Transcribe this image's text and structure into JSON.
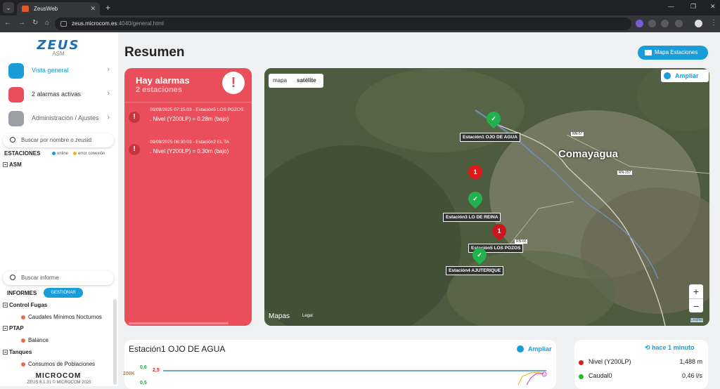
{
  "browser": {
    "tab_title": "ZeusWeb",
    "url_host": "zeus.microcom.es",
    "url_path": ":4040/general.html"
  },
  "sidebar": {
    "logo": "ZEUS",
    "logo_sub": "ASM",
    "menu": [
      {
        "label": "Vista general",
        "color": "#1a9cd8"
      },
      {
        "label": "2 alarmas activas",
        "color": "#e94e5a"
      },
      {
        "label": "Administración / Ajustes",
        "color": "#9aa0a6"
      }
    ],
    "search_stations_placeholder": "Buscar por nombre o zeusid",
    "stations_title": "ESTACIONES",
    "legend_online": "online",
    "legend_error": "error conexión",
    "tree_root": "ASM",
    "search_reports_placeholder": "Buscar informe",
    "reports_title": "INFORMES",
    "gestionar": "GESTIONAR",
    "report_groups": [
      {
        "name": "Control Fugas",
        "children": [
          "Caudales Mínimos Nocturnos"
        ]
      },
      {
        "name": "PTAP",
        "children": [
          "Balance"
        ]
      },
      {
        "name": "Tanques",
        "children": [
          "Consumos de Poblaciones"
        ]
      }
    ],
    "footer_logo": "MICROCOM",
    "footer_version": "ZEUS 6.1.31 © MICROCOM 2025"
  },
  "main": {
    "title": "Resumen",
    "map_button": "Mapa Estaciones",
    "alarms": {
      "title": "Hay alarmas",
      "subtitle": "2 estaciones",
      "items": [
        {
          "line1": "09/09/2025 07:15:03 - Estación5 LOS POZOS",
          "line2": ". Nivel (Y200LP) = 0.28m (bajo)"
        },
        {
          "line1": "09/09/2025 06:30:03 - Estación2 EL TA",
          "line2": ". Nivel (Y200LP) = 0.30m (bajo)"
        }
      ]
    },
    "map": {
      "tab_map": "mapa",
      "tab_sat": "satélite",
      "ampliar": "Ampliar",
      "city": "Comayagua",
      "roads": [
        "RN-57",
        "RN-157",
        "RN-66"
      ],
      "stations": [
        {
          "name": "Estación1 OJO DE AGUA",
          "status": "ok"
        },
        {
          "name": "Estación3 LO DE REINA",
          "status": "ok"
        },
        {
          "name": "Estación5 LOS POZOS",
          "status": "alarm"
        },
        {
          "name": "Estación4 AJUTERIQUE",
          "status": "ok"
        }
      ],
      "cluster_count": "1",
      "alarm_count": "1",
      "maps_logo": "Mapas",
      "legal": "Legal",
      "leaflet": "Leaflet"
    },
    "station_card": {
      "title": "Estación1 OJO DE AGUA",
      "ampliar": "Ampliar",
      "axis_left": [
        "200K"
      ],
      "axis_green": [
        "0,6",
        "0,5"
      ],
      "axis_red": "2,5"
    },
    "status_card": {
      "ago": "hace 1 minuto",
      "metrics": [
        {
          "label": "Nivel (Y200LP)",
          "value": "1,488 m",
          "color": "#e01a1a"
        },
        {
          "label": "Caudal0",
          "value": "0,46 l/s",
          "color": "#22bb33"
        }
      ]
    }
  }
}
